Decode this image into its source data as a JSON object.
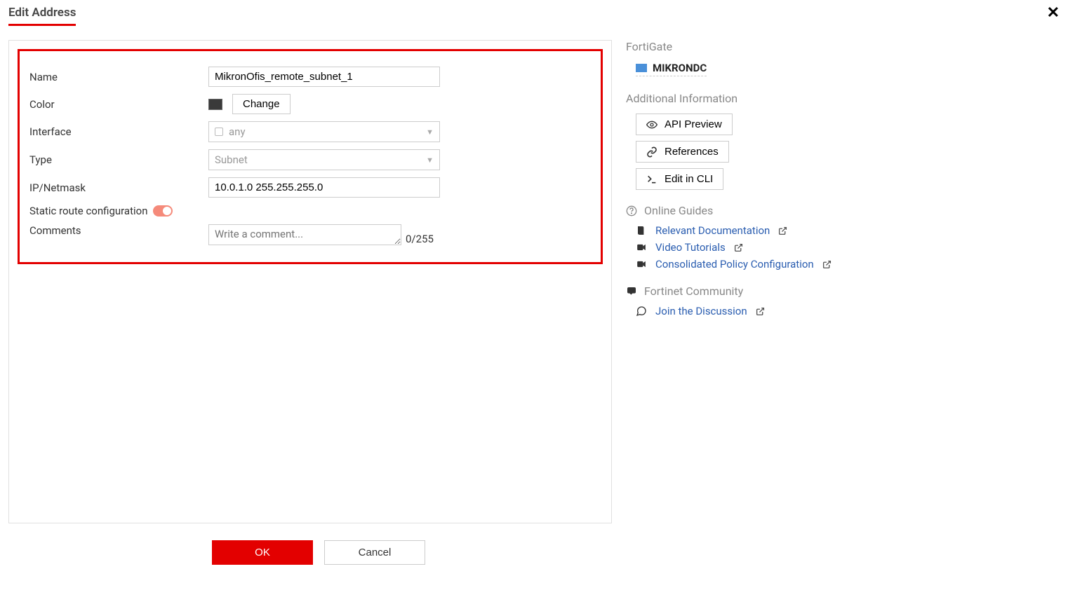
{
  "header": {
    "title": "Edit Address"
  },
  "form": {
    "labels": {
      "name": "Name",
      "color": "Color",
      "interface": "Interface",
      "type": "Type",
      "ip_netmask": "IP/Netmask",
      "static_route": "Static route configuration",
      "comments": "Comments"
    },
    "values": {
      "name": "MikronOfis_remote_subnet_1",
      "interface": "any",
      "type": "Subnet",
      "ip_netmask": "10.0.1.0 255.255.255.0"
    },
    "change_button": "Change",
    "comments_placeholder": "Write a comment...",
    "comments_counter": "0/255"
  },
  "side": {
    "fortigate_heading": "FortiGate",
    "device_name": "MIKRONDC",
    "additional_heading": "Additional Information",
    "actions": {
      "api_preview": "API Preview",
      "references": "References",
      "edit_cli": "Edit in CLI"
    },
    "online_guides_heading": "Online Guides",
    "guides": {
      "documentation": "Relevant Documentation",
      "video": "Video Tutorials",
      "policy": "Consolidated Policy Configuration"
    },
    "community_heading": "Fortinet Community",
    "community_link": "Join the Discussion"
  },
  "footer": {
    "ok": "OK",
    "cancel": "Cancel"
  }
}
